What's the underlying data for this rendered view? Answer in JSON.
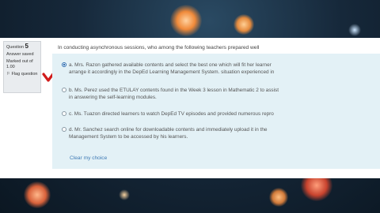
{
  "question_info": {
    "question_label": "Question",
    "question_number": "5",
    "status": "Answer saved",
    "marks": "Marked out of 1.00",
    "flag_label": "Flag question"
  },
  "question_text": "In conducting asynchronous sessions, who among the following teachers prepared well",
  "options": [
    {
      "letter": "a.",
      "line1": "Mrs. Razon gathered available contents and select the best one which will fit her learner",
      "line2": "arrange it accordingly in the DepEd Learning Management System.                 situation experienced in",
      "selected": true
    },
    {
      "letter": "b.",
      "line1": "Ms. Perez used the ETULAY contents found in the Week 3 lesson in Mathematic 2 to assist",
      "line2": "in answering the self-learning modules.",
      "selected": false
    },
    {
      "letter": "c.",
      "line1": "Ms. Tuazon directed learners to watch DepEd TV episodes and provided numerous repro",
      "line2": "",
      "selected": false
    },
    {
      "letter": "d.",
      "line1": "Mr. Sanchez search online for downloadable contents and immediately upload it in the",
      "line2": "Management System to be accessed by his learners.",
      "selected": false
    }
  ],
  "clear_choice": "Clear my choice",
  "colors": {
    "checkmark": "#d11b1b",
    "panel": "#e3f1f6",
    "link": "#3f7bb5"
  }
}
